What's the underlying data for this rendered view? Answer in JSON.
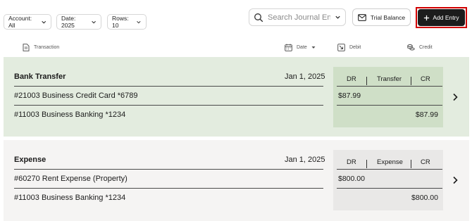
{
  "filters": {
    "account": "Account: All",
    "date": "Date: 2025",
    "rows": "Rows: 10"
  },
  "search": {
    "placeholder": "Search Journal Entries"
  },
  "buttons": {
    "trial_balance": "Trial Balance",
    "add_entry": "Add Entry"
  },
  "columns": {
    "transaction": "Transaction",
    "date": "Date",
    "debit": "Debit",
    "credit": "Credit"
  },
  "entries": [
    {
      "type": "Bank Transfer",
      "date": "Jan 1, 2025",
      "debit_account": "#21003 Business Credit Card *6789",
      "credit_account": "#11003 Business Banking *1234",
      "dr_label": "DR",
      "kind": "Transfer",
      "cr_label": "CR",
      "debit_amount": "$87.99",
      "credit_amount": "$87.99"
    },
    {
      "type": "Expense",
      "date": "Jan 1, 2025",
      "debit_account": "#60270 Rent Expense (Property)",
      "credit_account": "#11003 Business Banking *1234",
      "dr_label": "DR",
      "kind": "Expense",
      "cr_label": "CR",
      "debit_amount": "$800.00",
      "credit_amount": "$800.00"
    }
  ],
  "colors": {
    "accent_dark": "#1c1c1c",
    "highlight": "#d10000",
    "entry_green": "#e3ecdf",
    "entry_grey": "#f5f4f3"
  }
}
